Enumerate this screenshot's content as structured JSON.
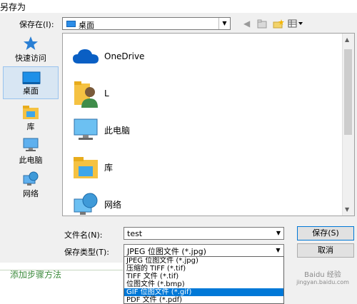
{
  "window": {
    "title": "另存为"
  },
  "toolbar": {
    "savein_label": "保存在(I):",
    "savein_value": "桌面",
    "icons": [
      "back-arrow-icon",
      "up-folder-icon",
      "new-folder-icon",
      "view-menu-icon"
    ]
  },
  "places": [
    {
      "label": "快速访问",
      "icon": "star-icon"
    },
    {
      "label": "桌面",
      "icon": "desktop-icon",
      "selected": true
    },
    {
      "label": "库",
      "icon": "library-icon"
    },
    {
      "label": "此电脑",
      "icon": "computer-icon"
    },
    {
      "label": "网络",
      "icon": "network-icon"
    }
  ],
  "files": [
    {
      "name": "OneDrive",
      "icon": "cloud-icon"
    },
    {
      "name": "L",
      "icon": "user-folder-icon"
    },
    {
      "name": "此电脑",
      "icon": "computer-icon"
    },
    {
      "name": "库",
      "icon": "library-icon"
    },
    {
      "name": "网络",
      "icon": "network-icon"
    }
  ],
  "form": {
    "filename_label": "文件名(N):",
    "filename_value": "test",
    "filetype_label": "保存类型(T):",
    "filetype_value": "JPEG 位图文件 (*.jpg)",
    "save_label": "保存(S)",
    "cancel_label": "取消"
  },
  "filetype_options": [
    "JPEG 位图文件 (*.jpg)",
    "压缩的 TIFF (*.tif)",
    "TIFF 文件 (*.tif)",
    "位图文件 (*.bmp)",
    "GIF 位图文件 (*.gif)",
    "PDF 文件 (*.pdf)"
  ],
  "filetype_selected_index": 4,
  "background": {
    "text": "添加步骤方法"
  },
  "watermark": {
    "line1": "Baidu 经验",
    "line2": "jingyan.baidu.com"
  },
  "colors": {
    "selection": "#0078d7",
    "place_selected": "#d8e6f3"
  }
}
